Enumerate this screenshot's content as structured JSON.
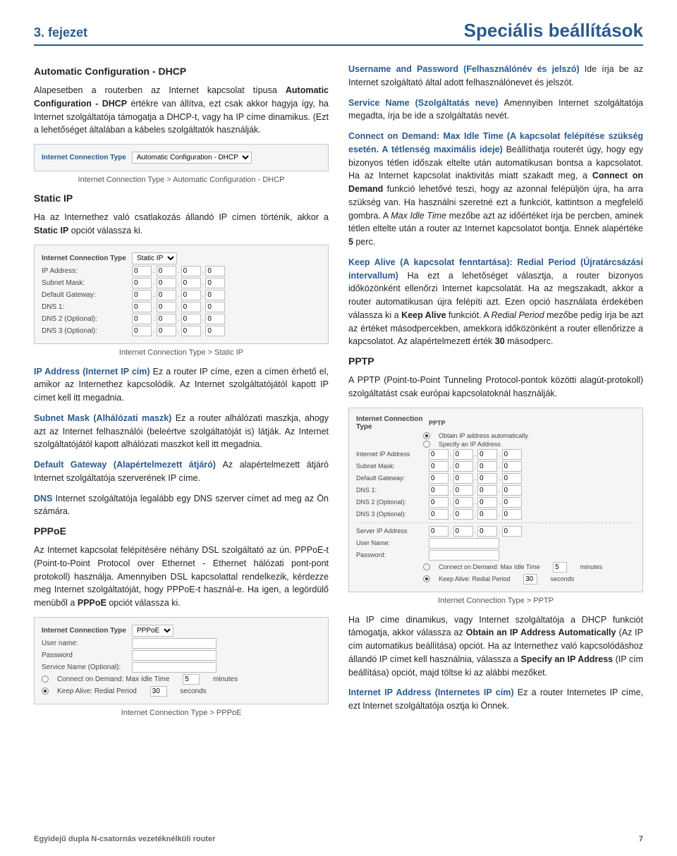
{
  "header": {
    "chapter": "3. fejezet",
    "title": "Speciális beállítások"
  },
  "left": {
    "autoDhcp": {
      "title": "Automatic Configuration - DHCP",
      "body": "Alapesetben a routerben az Internet kapcsolat típusa Automatic Configuration - DHCP értékre van állítva, ezt csak akkor hagyja így, ha Internet szolgáltatója támogatja a DHCP-t, vagy ha IP címe dinamikus. (Ezt a lehetőséget általában a kábeles szolgáltatók használják.",
      "innerBold": "Automatic Configuration - DHCP",
      "shot": {
        "label": "Internet Connection Type",
        "value": "Automatic Configuration - DHCP"
      },
      "caption": "Internet Connection Type > Automatic Configuration - DHCP"
    },
    "staticIp": {
      "title": "Static IP",
      "intro": "Ha az Internethez való csatlakozás állandó IP címen történik, akkor a Static IP opciót válassza ki.",
      "introBold": "Static IP",
      "shot": {
        "label": "Internet Connection Type",
        "value": "Static IP",
        "rows": [
          "IP Address:",
          "Subnet Mask:",
          "Default Gateway:",
          "DNS 1:",
          "DNS 2 (Optional):",
          "DNS 3 (Optional):"
        ],
        "oct": "0"
      },
      "caption": "Internet Connection Type > Static IP",
      "ipTerm": "IP Address (Internet IP cím)",
      "ipText": "Ez a router IP címe, ezen a címen érhető el, amikor az Internethez kapcsolódik. Az Internet szolgáltatójától kapott IP címet kell itt megadnia.",
      "subnetTerm": "Subnet Mask (Alhálózati maszk)",
      "subnetText": "Ez a router alhálózati maszkja, ahogy azt az Internet felhasználói (beleértve szolgáltatóját is) látják. Az Internet szolgáltatójától kapott alhálózati maszkot kell itt megadnia.",
      "gwTerm": "Default Gateway (Alapértelmezett átjáró)",
      "gwText": "Az alapértelmezett átjáró Internet szolgáltatója szerverének IP címe.",
      "dnsTerm": "DNS",
      "dnsText": "Internet szolgáltatója legalább egy DNS szerver címet ad meg az Ön számára."
    },
    "pppoe": {
      "title": "PPPoE",
      "body": "Az Internet kapcsolat felépítésére néhány DSL szolgáltató az ún. PPPoE-t (Point-to-Point Protocol over Ethernet - Ethernet hálózati pont-pont protokoll) használja. Amennyiben DSL kapcsolattal rendelkezik, kérdezze meg Internet szolgáltatóját, hogy PPPoE-t használ-e. Ha igen, a legördülő menüből a PPPoE opciót válassza ki.",
      "bold": "PPPoE",
      "shot": {
        "label": "Internet Connection Type",
        "value": "PPPoE",
        "user": "User name:",
        "pass": "Password",
        "service": "Service Name (Optional):",
        "cod": "Connect on Demand: Max Idle Time",
        "codVal": "5",
        "codUnit": "minutes",
        "ka": "Keep Alive: Redial Period",
        "kaVal": "30",
        "kaUnit": "seconds"
      },
      "caption": "Internet Connection Type > PPPoE"
    }
  },
  "right": {
    "userPass": {
      "term": "Username and Password (Felhasználónév és jelszó)",
      "text": "Ide írja be az Internet szolgáltató által adott felhasználónevet és jelszót."
    },
    "serviceName": {
      "term": "Service Name (Szolgáltatás neve)",
      "text": "Amennyiben Internet szolgáltatója megadta, írja be ide a szolgáltatás nevét."
    },
    "cod": {
      "term": "Connect on Demand: Max Idle Time (A kapcsolat felépítése szükség esetén. A tétlenség maximális ideje)",
      "text": "Beállíthatja routerét úgy, hogy egy bizonyos tétlen időszak eltelte után automatikusan bontsa a kapcsolatot. Ha az Internet kapcsolat inaktivitás miatt szakadt meg, a Connect on Demand funkció lehetővé teszi, hogy az azonnal felépüljön újra, ha arra szükség van. Ha használni szeretné ezt a funkciót, kattintson a megfelelő gombra. A Max Idle Time mezőbe azt az időértéket írja be percben, aminek tétlen eltelte után a router az Internet kapcsolatot bontja. Ennek alapértéke 5 perc.",
      "bold1": "Connect on Demand",
      "bold2": "5"
    },
    "keepAlive": {
      "term": "Keep Alive (A kapcsolat fenntartása): Redial Period (Újratárcsázási intervallum)",
      "text": "Ha ezt a lehetőséget választja, a router bizonyos időközönként ellenőrzi Internet kapcsolatát. Ha az megszakadt, akkor a router automatikusan újra felépíti azt. Ezen opció használata érdekében válassza ki a Keep Alive funkciót. A Redial Period mezőbe pedig írja be azt az értéket másodpercekben, amekkora időközönként a router ellenőrizze a kapcsolatot. Az alapértelmezett érték 30 másodperc.",
      "bold1": "Keep Alive",
      "bold2": "30"
    },
    "pptp": {
      "title": "PPTP",
      "intro": "A PPTP (Point-to-Point Tunneling Protocol-pontok közötti alagút-protokoll) szolgáltatást csak európai kapcsolatoknál használják.",
      "shot": {
        "label": "Internet Connection Type",
        "value": "PPTP",
        "r1": "Obtain IP address automatically",
        "r2": "Specify an IP Address",
        "rows": [
          "Internet IP Address",
          "Subnet Mask:",
          "Default Gateway:",
          "DNS 1:",
          "DNS 2 (Optional):",
          "DNS 3 (Optional):"
        ],
        "serverIp": "Server IP Address",
        "user": "User Name:",
        "pass": "Password:",
        "cod": "Connect on Demand: Max Idle Time",
        "codVal": "5",
        "codUnit": "minutes",
        "ka": "Keep Alive: Redial Period",
        "kaVal": "30",
        "kaUnit": "seconds",
        "oct": "0"
      },
      "caption": "Internet Connection Type > PPTP",
      "afterTerm1": "Obtain an IP Address Automatically",
      "afterTerm2": "Specify an IP Address",
      "after": "Ha IP címe dinamikus, vagy Internet szolgáltatója a DHCP funkciót támogatja, akkor válassza az Obtain an IP Address Automatically (Az IP cím automatikus beállítása) opciót. Ha az Internethez való kapcsolódáshoz állandó IP címet kell használnia, válassza a Specify an IP Address (IP cím beállítása) opciót, majd töltse ki az alábbi mezőket.",
      "iipTerm": "Internet IP Address (Internetes IP cím)",
      "iipText": "Ez a router Internetes IP címe, ezt Internet szolgáltatója osztja ki Önnek."
    }
  },
  "footer": {
    "left": "Egyidejű dupla N-csatornás vezetéknélküli router",
    "right": "7"
  }
}
